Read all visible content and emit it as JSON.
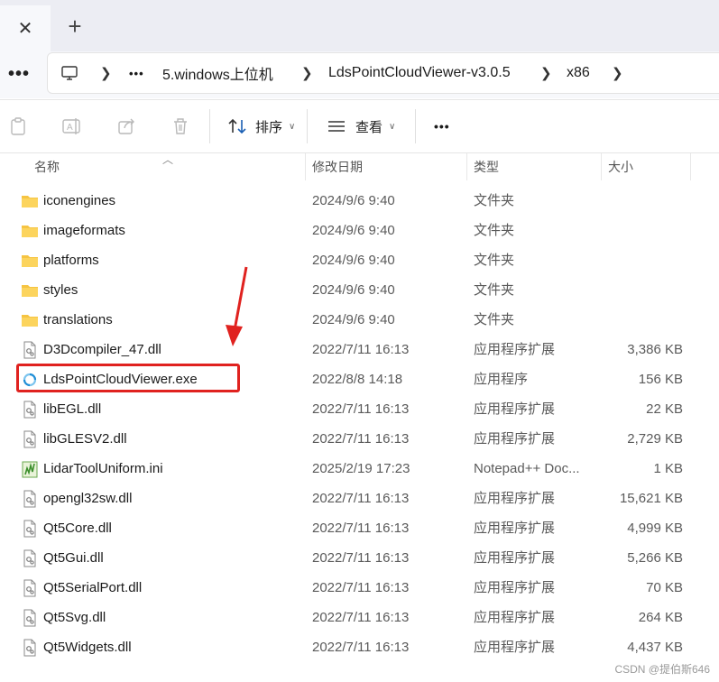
{
  "tab": {
    "close_glyph": "✕",
    "new_tab_glyph": "+"
  },
  "address": {
    "more_left": "•••",
    "crumbs": [
      "•••",
      "5.windows上位机",
      "LdsPointCloudViewer-v3.0.5",
      "x86"
    ]
  },
  "toolbar": {
    "sort_label": "排序",
    "view_label": "查看",
    "more_label": "•••"
  },
  "columns": {
    "name": "名称",
    "date": "修改日期",
    "type": "类型",
    "size": "大小"
  },
  "files": [
    {
      "name": "iconengines",
      "date": "2024/9/6 9:40",
      "type": "文件夹",
      "size": "",
      "icon": "folder-icon"
    },
    {
      "name": "imageformats",
      "date": "2024/9/6 9:40",
      "type": "文件夹",
      "size": "",
      "icon": "folder-icon"
    },
    {
      "name": "platforms",
      "date": "2024/9/6 9:40",
      "type": "文件夹",
      "size": "",
      "icon": "folder-icon"
    },
    {
      "name": "styles",
      "date": "2024/9/6 9:40",
      "type": "文件夹",
      "size": "",
      "icon": "folder-icon"
    },
    {
      "name": "translations",
      "date": "2024/9/6 9:40",
      "type": "文件夹",
      "size": "",
      "icon": "folder-icon"
    },
    {
      "name": "D3Dcompiler_47.dll",
      "date": "2022/7/11 16:13",
      "type": "应用程序扩展",
      "size": "3,386 KB",
      "icon": "dll-file-icon"
    },
    {
      "name": "LdsPointCloudViewer.exe",
      "date": "2022/8/8 14:18",
      "type": "应用程序",
      "size": "156 KB",
      "icon": "exe-app-icon"
    },
    {
      "name": "libEGL.dll",
      "date": "2022/7/11 16:13",
      "type": "应用程序扩展",
      "size": "22 KB",
      "icon": "dll-file-icon"
    },
    {
      "name": "libGLESV2.dll",
      "date": "2022/7/11 16:13",
      "type": "应用程序扩展",
      "size": "2,729 KB",
      "icon": "dll-file-icon"
    },
    {
      "name": "LidarToolUniform.ini",
      "date": "2025/2/19 17:23",
      "type": "Notepad++ Doc...",
      "size": "1 KB",
      "icon": "notepad-file-icon"
    },
    {
      "name": "opengl32sw.dll",
      "date": "2022/7/11 16:13",
      "type": "应用程序扩展",
      "size": "15,621 KB",
      "icon": "dll-file-icon"
    },
    {
      "name": "Qt5Core.dll",
      "date": "2022/7/11 16:13",
      "type": "应用程序扩展",
      "size": "4,999 KB",
      "icon": "dll-file-icon"
    },
    {
      "name": "Qt5Gui.dll",
      "date": "2022/7/11 16:13",
      "type": "应用程序扩展",
      "size": "5,266 KB",
      "icon": "dll-file-icon"
    },
    {
      "name": "Qt5SerialPort.dll",
      "date": "2022/7/11 16:13",
      "type": "应用程序扩展",
      "size": "70 KB",
      "icon": "dll-file-icon"
    },
    {
      "name": "Qt5Svg.dll",
      "date": "2022/7/11 16:13",
      "type": "应用程序扩展",
      "size": "264 KB",
      "icon": "dll-file-icon"
    },
    {
      "name": "Qt5Widgets.dll",
      "date": "2022/7/11 16:13",
      "type": "应用程序扩展",
      "size": "4,437 KB",
      "icon": "dll-file-icon"
    }
  ],
  "annotation": {
    "color": "#e0221f"
  },
  "watermark": "CSDN @提伯斯646"
}
